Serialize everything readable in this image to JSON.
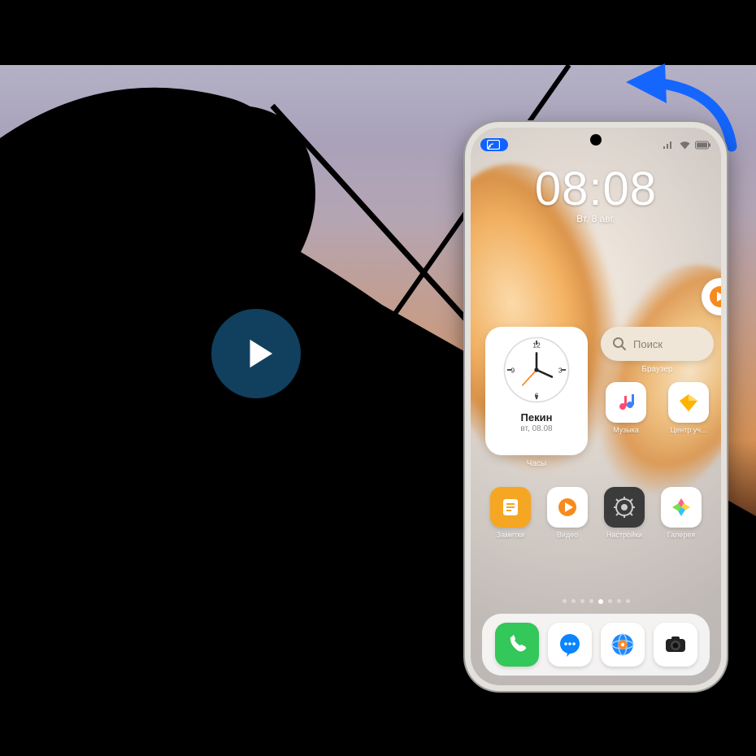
{
  "clock": {
    "time": "08:08",
    "date": "Вт, 8 авг."
  },
  "widgets": {
    "clock": {
      "city": "Пекин",
      "date": "вт, 08.08",
      "label": "Часы"
    },
    "search": {
      "placeholder": "Поиск",
      "label": "Браузер"
    }
  },
  "apps": {
    "music": {
      "label": "Музыка"
    },
    "member": {
      "label": "Центр уч..."
    },
    "notes": {
      "label": "Заметки"
    },
    "video": {
      "label": "Видео"
    },
    "settings": {
      "label": "Настройки"
    },
    "gallery": {
      "label": "Галерея"
    }
  },
  "dock": {
    "phone": {
      "name": "phone-app"
    },
    "messages": {
      "name": "messages-app"
    },
    "browser": {
      "name": "browser-app"
    },
    "camera": {
      "name": "camera-app"
    }
  },
  "colors": {
    "accentBlue": "#1062ff",
    "arrowBlue": "#1566ff",
    "playBg": "#134b6f",
    "orange": "#f58b1f",
    "green": "#34c759",
    "yellow": "#ffd33c"
  }
}
